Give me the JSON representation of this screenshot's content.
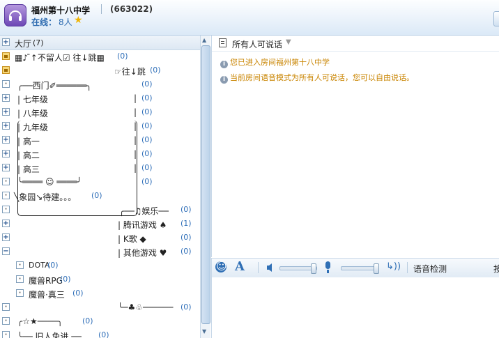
{
  "header": {
    "room_name": "福州第十八中学",
    "room_id": "(663022)",
    "online_label": "在线：",
    "online_count": "8人"
  },
  "channels": {
    "hall": {
      "label": "大厅",
      "count": "(7)"
    },
    "rows": [
      {
        "label": "▦♪ ̄↑不留人☑ 往↓跳▦",
        "count": "(0)"
      },
      {
        "label": "☞往↓跳",
        "count": "(0)"
      },
      {
        "label": "╭──西门✐══════╮",
        "count": "(0)"
      },
      {
        "label": "| 七年级",
        "count": "(0)"
      },
      {
        "label": "| 八年级",
        "count": "(0)"
      },
      {
        "label": "| 九年级",
        "count": "(0)"
      },
      {
        "label": "| 高一",
        "count": "(0)"
      },
      {
        "label": "| 高二",
        "count": "(0)"
      },
      {
        "label": "| 高三",
        "count": "(0)"
      },
      {
        "label": "╰════ ☺ ════╯",
        "count": "(0)"
      },
      {
        "label": "╲象园↘待建。。。",
        "count": "(0)"
      },
      {
        "label": "╭──♫娱乐──",
        "count": "(0)"
      },
      {
        "label": "| 腾讯游戏 ♠",
        "count": "(1)"
      },
      {
        "label": "|    K歌    ◆",
        "count": "(0)"
      },
      {
        "label": "| 其他游戏 ♥",
        "count": "(0)"
      },
      {
        "label": "DOTA",
        "count": "(0)"
      },
      {
        "label": "魔兽RPG",
        "count": "(0)"
      },
      {
        "label": "魔兽·真三",
        "count": "(0)"
      },
      {
        "label": "╰─♣♧──────",
        "count": "(0)"
      },
      {
        "label": "╭☆★────╮",
        "count": "(0)"
      },
      {
        "label": "╰── 旧人免进 ──",
        "count": "(0)"
      }
    ]
  },
  "chat": {
    "mode_label": "所有人可说话",
    "messages": [
      "您已进入房间福州第十八中学",
      "当前房间语音模式为所有人可说话，您可以自由说话。"
    ]
  },
  "toolbar": {
    "voice_detect": "语音检测",
    "more": "按"
  },
  "icons": {
    "room": "headset-icon",
    "star": "star-icon",
    "emoji": "smile-icon",
    "font": "font-icon",
    "speaker": "speaker-icon",
    "mic": "microphone-icon",
    "voice": "voice-icon"
  },
  "colors": {
    "accent": "#2f6fb5",
    "count": "#2e6eb8",
    "system_message": "#c98400",
    "header_bg": "#dbe9f7"
  }
}
